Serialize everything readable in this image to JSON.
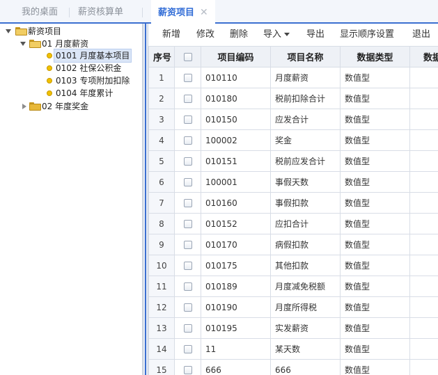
{
  "tabs": [
    {
      "label": "我的桌面",
      "active": false
    },
    {
      "label": "薪资核算单",
      "active": false
    },
    {
      "label": "薪资项目",
      "active": true,
      "closable": true
    }
  ],
  "tree": {
    "root": "薪资项目",
    "groups": [
      {
        "label": "01 月度薪资",
        "expanded": true,
        "children": [
          "0101 月度基本项目",
          "0102 社保公积金",
          "0103 专项附加扣除",
          "0104 年度累计"
        ]
      },
      {
        "label": "02 年度奖金",
        "expanded": false,
        "children": []
      }
    ],
    "selected": "0101 月度基本项目"
  },
  "toolbar": {
    "add": "新增",
    "edit": "修改",
    "delete": "删除",
    "import": "导入",
    "export": "导出",
    "display_order": "显示顺序设置",
    "exit": "退出"
  },
  "grid": {
    "headers": [
      "序号",
      "",
      "项目编码",
      "项目名称",
      "数据类型",
      "数据"
    ],
    "rows": [
      {
        "idx": "1",
        "code": "010110",
        "name": "月度薪资",
        "type": "数值型"
      },
      {
        "idx": "2",
        "code": "010180",
        "name": "税前扣除合计",
        "type": "数值型"
      },
      {
        "idx": "3",
        "code": "010150",
        "name": "应发合计",
        "type": "数值型"
      },
      {
        "idx": "4",
        "code": "100002",
        "name": "奖金",
        "type": "数值型"
      },
      {
        "idx": "5",
        "code": "010151",
        "name": "税前应发合计",
        "type": "数值型"
      },
      {
        "idx": "6",
        "code": "100001",
        "name": "事假天数",
        "type": "数值型"
      },
      {
        "idx": "7",
        "code": "010160",
        "name": "事假扣款",
        "type": "数值型"
      },
      {
        "idx": "8",
        "code": "010152",
        "name": "应扣合计",
        "type": "数值型"
      },
      {
        "idx": "9",
        "code": "010170",
        "name": "病假扣款",
        "type": "数值型"
      },
      {
        "idx": "10",
        "code": "010175",
        "name": "其他扣款",
        "type": "数值型"
      },
      {
        "idx": "11",
        "code": "010189",
        "name": "月度减免税额",
        "type": "数值型"
      },
      {
        "idx": "12",
        "code": "010190",
        "name": "月度所得税",
        "type": "数值型"
      },
      {
        "idx": "13",
        "code": "010195",
        "name": "实发薪资",
        "type": "数值型"
      },
      {
        "idx": "14",
        "code": "11",
        "name": "某天数",
        "type": "数值型"
      },
      {
        "idx": "15",
        "code": "666",
        "name": "666",
        "type": "数值型"
      }
    ]
  }
}
